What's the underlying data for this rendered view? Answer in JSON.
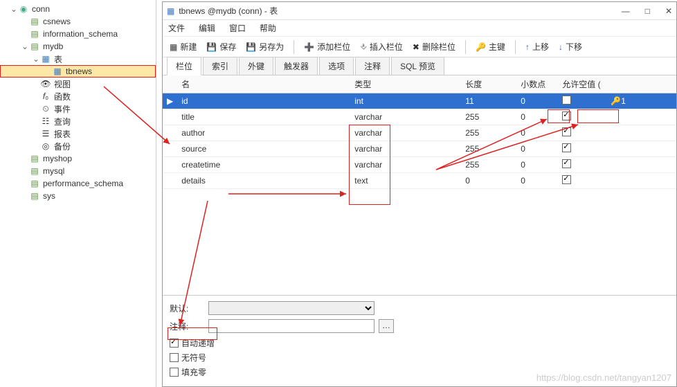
{
  "tree": {
    "root": "conn",
    "items": [
      "csnews",
      "information_schema",
      "mydb",
      "表",
      "tbnews",
      "视图",
      "函数",
      "事件",
      "查询",
      "报表",
      "备份",
      "myshop",
      "mysql",
      "performance_schema",
      "sys"
    ]
  },
  "win": {
    "title": "tbnews @mydb (conn) - 表",
    "min": "—",
    "max": "□",
    "close": "✕"
  },
  "menu": [
    "文件",
    "编辑",
    "窗口",
    "帮助"
  ],
  "toolbar": {
    "new": "新建",
    "save": "保存",
    "saveas": "另存为",
    "addcol": "添加栏位",
    "inscol": "插入栏位",
    "delcol": "删除栏位",
    "pkey": "主键",
    "up": "上移",
    "down": "下移"
  },
  "tabs": [
    "栏位",
    "索引",
    "外键",
    "触发器",
    "选项",
    "注释",
    "SQL 预览"
  ],
  "grid": {
    "headers": [
      "名",
      "类型",
      "长度",
      "小数点",
      "允许空值 (",
      " "
    ],
    "rows": [
      {
        "name": "id",
        "type": "int",
        "len": "11",
        "dec": "0",
        "null": false,
        "key": "1"
      },
      {
        "name": "title",
        "type": "varchar",
        "len": "255",
        "dec": "0",
        "null": true,
        "key": ""
      },
      {
        "name": "author",
        "type": "varchar",
        "len": "255",
        "dec": "0",
        "null": true,
        "key": ""
      },
      {
        "name": "source",
        "type": "varchar",
        "len": "255",
        "dec": "0",
        "null": true,
        "key": ""
      },
      {
        "name": "createtime",
        "type": "varchar",
        "len": "255",
        "dec": "0",
        "null": true,
        "key": ""
      },
      {
        "name": "details",
        "type": "text",
        "len": "0",
        "dec": "0",
        "null": true,
        "key": ""
      }
    ]
  },
  "form": {
    "default": "默认:",
    "comment": "注释:",
    "autoinc": "自动递增",
    "unsigned": "无符号",
    "zerofill": "填充零"
  },
  "watermark": "https://blog.csdn.net/tangyan1207"
}
